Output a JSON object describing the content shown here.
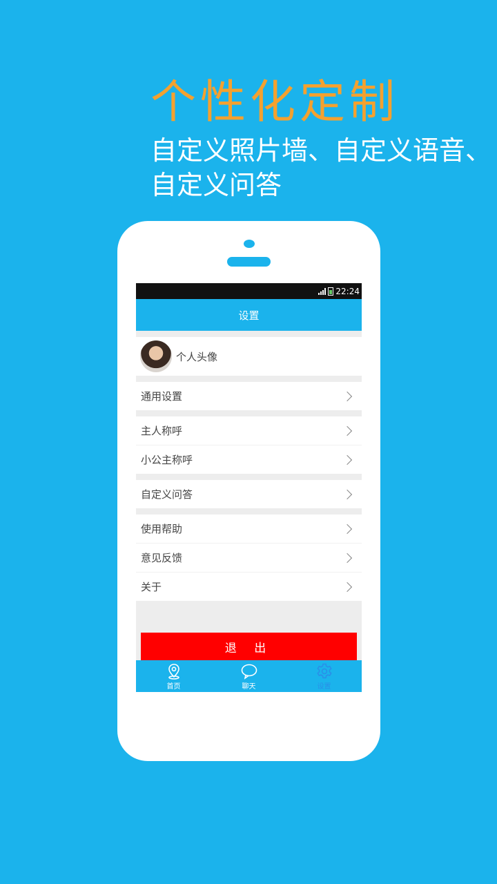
{
  "promo": {
    "title": "个性化定制",
    "subtitle_line1": "自定义照片墙、自定义语音、",
    "subtitle_line2": "自定义问答"
  },
  "status_bar": {
    "time": "22:24"
  },
  "app_bar": {
    "title": "设置"
  },
  "profile": {
    "label": "个人头像"
  },
  "menu": {
    "general": "通用设置",
    "owner_name": "主人称呼",
    "princess_name": "小公主称呼",
    "custom_qa": "自定义问答",
    "help": "使用帮助",
    "feedback": "意见反馈",
    "about": "关于"
  },
  "logout": {
    "label": "退 出"
  },
  "tabs": [
    {
      "label": "首页",
      "icon": "location-pin-icon"
    },
    {
      "label": "聊天",
      "icon": "chat-bubble-icon"
    },
    {
      "label": "设置",
      "icon": "gear-icon"
    }
  ],
  "colors": {
    "background": "#1bb3ec",
    "title_accent": "#f4a12f",
    "logout": "#ff0000",
    "active_tab": "#2a8fe8"
  }
}
